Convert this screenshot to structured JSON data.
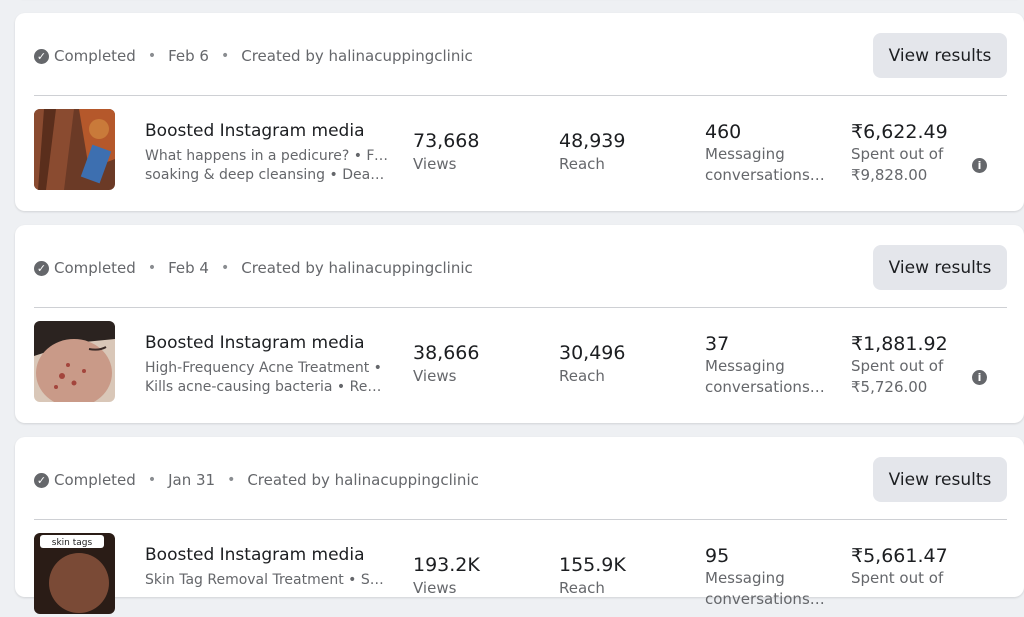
{
  "campaigns": [
    {
      "status": "Completed",
      "date": "Feb 6",
      "created_by": "Created by halinacuppingclinic",
      "button": "View results",
      "title": "Boosted Instagram media",
      "desc_line1": "What happens in a pedicure? • Foot",
      "desc_line2": "soaking & deep cleansing • Dead…",
      "views_value": "73,668",
      "views_label": "Views",
      "reach_value": "48,939",
      "reach_label": "Reach",
      "msg_value": "460",
      "msg_label1": "Messaging",
      "msg_label2": "conversations…",
      "spent_value": "₹6,622.49",
      "spent_label1": "Spent out of",
      "spent_label2": "₹9,828.00"
    },
    {
      "status": "Completed",
      "date": "Feb 4",
      "created_by": "Created by halinacuppingclinic",
      "button": "View results",
      "title": "Boosted Instagram media",
      "desc_line1": "High-Frequency Acne Treatment •",
      "desc_line2": "Kills acne-causing bacteria • Reduc…",
      "views_value": "38,666",
      "views_label": "Views",
      "reach_value": "30,496",
      "reach_label": "Reach",
      "msg_value": "37",
      "msg_label1": "Messaging",
      "msg_label2": "conversations…",
      "spent_value": "₹1,881.92",
      "spent_label1": "Spent out of",
      "spent_label2": "₹5,726.00"
    },
    {
      "status": "Completed",
      "date": "Jan 31",
      "created_by": "Created by halinacuppingclinic",
      "button": "View results",
      "title": "Boosted Instagram media",
      "desc_line1": "Skin Tag Removal Treatment • Safe",
      "desc_line2": "",
      "views_value": "193.2K",
      "views_label": "Views",
      "reach_value": "155.9K",
      "reach_label": "Reach",
      "msg_value": "95",
      "msg_label1": "Messaging",
      "msg_label2": "conversations…",
      "spent_value": "₹5,661.47",
      "spent_label1": "Spent out of",
      "spent_label2": "",
      "thumb_text": "skin tags"
    }
  ],
  "icons": {
    "status": "check-circle-icon",
    "info": "info-icon"
  }
}
